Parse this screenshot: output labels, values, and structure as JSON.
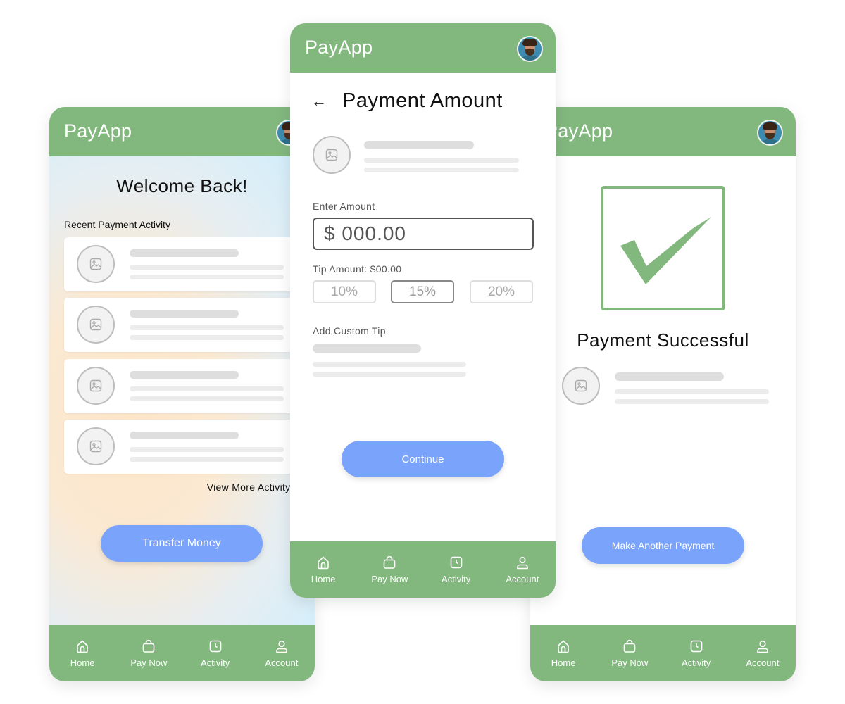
{
  "app": {
    "brand": "PayApp"
  },
  "home": {
    "welcome": "Welcome Back!",
    "recent_label": "Recent Payment Activity",
    "view_more": "View More Activity...",
    "transfer_button": "Transfer Money"
  },
  "payment": {
    "title": "Payment Amount",
    "enter_amount_label": "Enter Amount",
    "amount_value": "$ 000.00",
    "tip_label": "Tip Amount: $00.00",
    "tip_options": [
      "10%",
      "15%",
      "20%"
    ],
    "selected_tip": "15%",
    "custom_tip_label": "Add Custom Tip",
    "continue_button": "Continue"
  },
  "success": {
    "title": "Payment Successful",
    "another_button": "Make Another Payment"
  },
  "nav": {
    "items": [
      {
        "label": "Home",
        "icon": "home-icon"
      },
      {
        "label": "Pay Now",
        "icon": "bag-icon"
      },
      {
        "label": "Activity",
        "icon": "clock-icon"
      },
      {
        "label": "Account",
        "icon": "user-icon"
      }
    ]
  },
  "colors": {
    "header": "#82b87e",
    "button": "#7aa3fb",
    "placeholder": "#dedede"
  }
}
